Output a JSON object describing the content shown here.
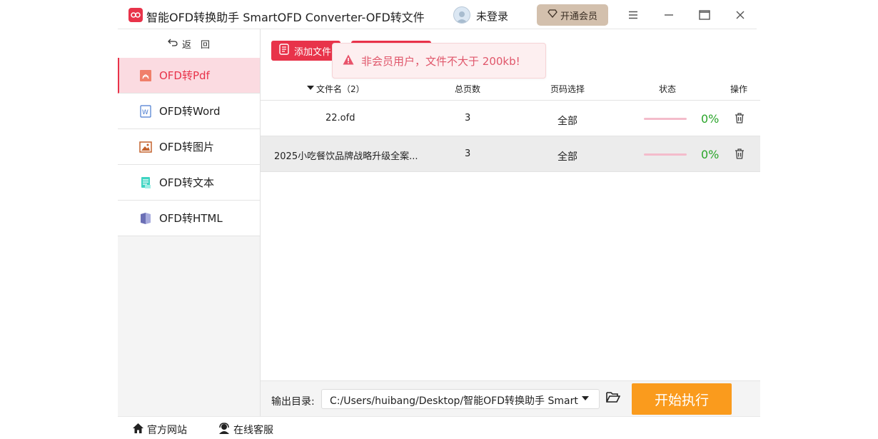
{
  "app": {
    "title": "智能OFD转换助手 SmartOFD Converter-OFD转文件",
    "user_label": "未登录",
    "vip_label": "开通会员"
  },
  "sidebar": {
    "back_label": "返　回",
    "items": [
      {
        "label": "OFD转Pdf",
        "icon": "pdf-icon",
        "active": true
      },
      {
        "label": "OFD转Word",
        "icon": "word-icon",
        "active": false
      },
      {
        "label": "OFD转图片",
        "icon": "image-icon",
        "active": false
      },
      {
        "label": "OFD转文本",
        "icon": "text-icon",
        "active": false
      },
      {
        "label": "OFD转HTML",
        "icon": "html-icon",
        "active": false
      }
    ]
  },
  "toolbar": {
    "add_file_label": "添加文件"
  },
  "toast": {
    "message": "非会员用户，文件不大于 200kb!"
  },
  "table": {
    "columns": [
      "文件名（2）",
      "总页数",
      "页码选择",
      "状态",
      "操作"
    ],
    "rows": [
      {
        "name": "22.ofd",
        "pages": "3",
        "range": "全部",
        "progress": 0,
        "percent": "0%"
      },
      {
        "name": "2025小吃餐饮品牌战略升级全案...",
        "pages": "3",
        "range": "全部",
        "progress": 0,
        "percent": "0%"
      }
    ]
  },
  "output": {
    "label": "输出目录:",
    "path": "C:/Users/huibang/Desktop/智能OFD转换助手 Smart",
    "start_label": "开始执行"
  },
  "footer": {
    "website_label": "官方网站",
    "service_label": "在线客服"
  },
  "colors": {
    "accent": "#e8334a",
    "active_bg": "#fbdbe1",
    "start_button": "#fa9b1d",
    "vip_button": "#d3c0ad",
    "success": "#2aa52a"
  }
}
